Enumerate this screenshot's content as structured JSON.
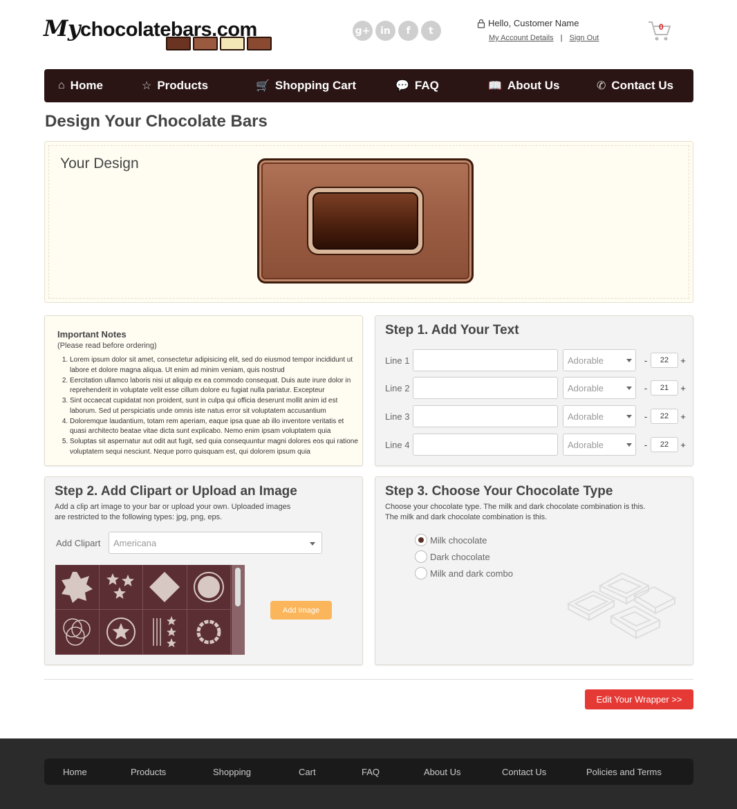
{
  "header": {
    "logo_prefix": "My",
    "logo_text": "chocolatebars.com",
    "greeting": "Hello, Customer Name",
    "account_link": "My Account Details",
    "sep": "|",
    "signout_link": "Sign Out",
    "cart_count": "0",
    "social": [
      "g+",
      "in",
      "f",
      "t"
    ]
  },
  "nav": [
    {
      "label": "Home",
      "icon": "⌂"
    },
    {
      "label": "Products",
      "icon": "☆"
    },
    {
      "label": "Shopping Cart",
      "icon": "🛒"
    },
    {
      "label": "FAQ",
      "icon": "💬"
    },
    {
      "label": "About Us",
      "icon": "📖"
    },
    {
      "label": "Contact Us",
      "icon": "✆"
    }
  ],
  "page_title": "Design Your Chocolate Bars",
  "design": {
    "heading": "Your Design"
  },
  "notes": {
    "title": "Important Notes",
    "subtitle": "(Please read before ordering)",
    "items": [
      "Lorem ipsum dolor sit amet, consectetur adipisicing elit, sed do eiusmod tempor incididunt ut labore et dolore magna aliqua. Ut enim ad minim veniam, quis nostrud",
      "Eercitation ullamco laboris nisi ut aliquip ex ea commodo consequat. Duis aute irure dolor in reprehenderit in voluptate velit esse cillum dolore eu fugiat nulla pariatur. Excepteur",
      "Sint occaecat cupidatat non proident, sunt in culpa qui officia deserunt mollit anim id est laborum. Sed ut perspiciatis unde omnis iste natus error sit voluptatem accusantium",
      "Doloremque laudantium, totam rem aperiam, eaque ipsa quae ab illo inventore veritatis et quasi architecto beatae vitae dicta sunt explicabo. Nemo enim ipsam voluptatem quia",
      "Soluptas sit aspernatur aut odit aut fugit, sed quia consequuntur magni dolores eos qui ratione voluptatem sequi nesciunt. Neque porro quisquam est, qui dolorem ipsum quia"
    ]
  },
  "step1": {
    "title": "Step 1. Add Your Text",
    "rows": [
      {
        "label": "Line 1",
        "font": "Adorable",
        "size": "22"
      },
      {
        "label": "Line 2",
        "font": "Adorable",
        "size": "21"
      },
      {
        "label": "Line 3",
        "font": "Adorable",
        "size": "22"
      },
      {
        "label": "Line 4",
        "font": "Adorable",
        "size": "22"
      }
    ],
    "minus": "-",
    "plus": "+"
  },
  "step2": {
    "title": "Step 2. Add Clipart or Upload an Image",
    "desc1": "Add a clip art image to your bar or upload your own. Uploaded images",
    "desc2": "are restricted to the following types: jpg, png, eps.",
    "clip_label": "Add Clipart",
    "clip_value": "Americana",
    "add_image": "Add Image"
  },
  "step3": {
    "title": "Step 3. Choose Your Chocolate Type",
    "desc1": "Choose your chocolate type. The milk and dark chocolate combination is this.",
    "desc2": "The milk and dark chocolate combination is this.",
    "options": [
      "Milk chocolate",
      "Dark chocolate",
      "Milk and dark combo"
    ],
    "selected": "Milk chocolate"
  },
  "edit_button": "Edit Your Wrapper >>",
  "footer": [
    "Home",
    "Products",
    "Shopping",
    "Cart",
    "FAQ",
    "About Us",
    "Contact Us",
    "Policies and Terms"
  ],
  "colors": {
    "nav_bg": "#2b1414",
    "accent_red": "#e53935",
    "add_image": "#fbb55a",
    "clip_bg": "#5a2e33"
  }
}
